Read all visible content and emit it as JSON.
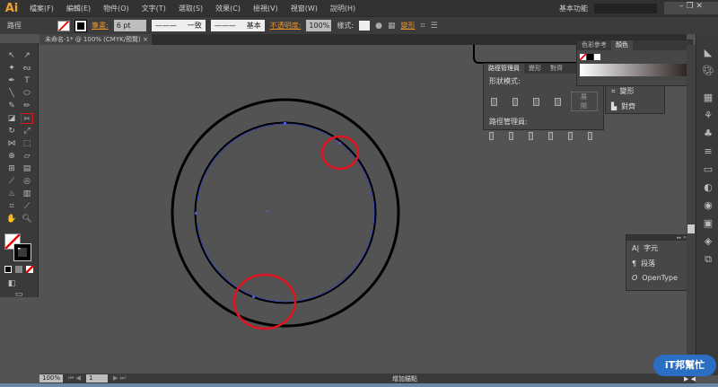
{
  "app": {
    "logo": "Ai",
    "workspace": "基本功能"
  },
  "menu": [
    "檔案(F)",
    "編輯(E)",
    "物件(O)",
    "文字(T)",
    "選取(S)",
    "效果(C)",
    "檢視(V)",
    "視窗(W)",
    "說明(H)"
  ],
  "control": {
    "object_type": "路徑",
    "stroke_label": "筆畫:",
    "stroke_weight": "6 pt",
    "profile": "一致",
    "brush": "基本",
    "opacity_label": "不透明度:",
    "opacity": "100%",
    "style_label": "樣式:",
    "transform": "變形"
  },
  "document_tab": {
    "title": "未命名-1* @ 100% (CMYK/預覽)",
    "close": "×"
  },
  "pathfinder_panel": {
    "tabs": [
      "路徑管理員",
      "變形",
      "對齊"
    ],
    "shape_modes": "形狀模式:",
    "expand": "展開",
    "pathfinders": "路徑管理員:"
  },
  "color_panel": {
    "tabs": [
      "色彩參考",
      "顏色"
    ]
  },
  "collapsed_panel": {
    "items": [
      "變形",
      "對齊"
    ]
  },
  "type_panel": {
    "items": [
      "字元",
      "段落",
      "OpenType"
    ]
  },
  "status": {
    "zoom": "100%",
    "artboard": "1",
    "tool_hint": "增加錨點"
  },
  "watermark": "iT邦幫忙",
  "colors": {
    "stroke": "#000000",
    "path_highlight": "#4a5bd8",
    "annotation": "#e0141e",
    "accent": "#e8902a"
  }
}
